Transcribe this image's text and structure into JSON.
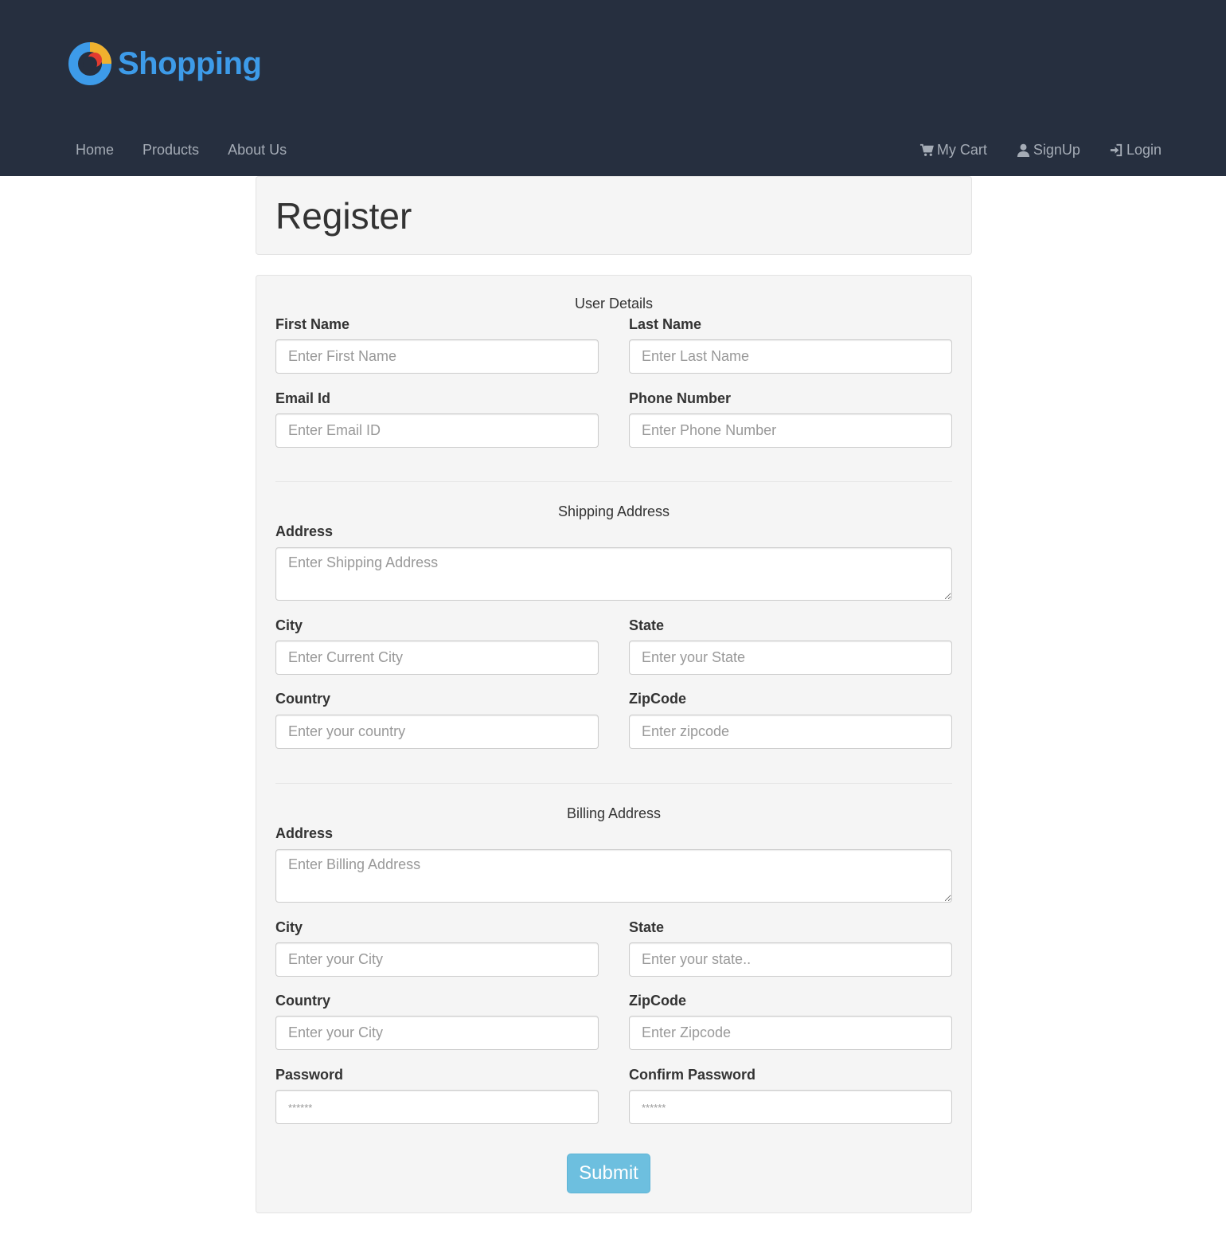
{
  "brand": {
    "name": "Shopping",
    "logo_icon": "shopping-logo-icon",
    "color": "#3d9be9"
  },
  "nav": {
    "left": [
      "Home",
      "Products",
      "About Us"
    ],
    "right": [
      {
        "label": "My Cart",
        "icon": "cart-icon"
      },
      {
        "label": "SignUp",
        "icon": "user-icon"
      },
      {
        "label": "Login",
        "icon": "login-icon"
      }
    ]
  },
  "page": {
    "title": "Register"
  },
  "form": {
    "user_details": {
      "heading": "User Details",
      "first_name": {
        "label": "First Name",
        "placeholder": "Enter First Name"
      },
      "last_name": {
        "label": "Last Name",
        "placeholder": "Enter Last Name"
      },
      "email": {
        "label": "Email Id",
        "placeholder": "Enter Email ID"
      },
      "phone": {
        "label": "Phone Number",
        "placeholder": "Enter Phone Number"
      }
    },
    "shipping": {
      "heading": "Shipping Address",
      "address": {
        "label": "Address",
        "placeholder": "Enter Shipping Address"
      },
      "city": {
        "label": "City",
        "placeholder": "Enter Current City"
      },
      "state": {
        "label": "State",
        "placeholder": "Enter your State"
      },
      "country": {
        "label": "Country",
        "placeholder": "Enter your country"
      },
      "zipcode": {
        "label": "ZipCode",
        "placeholder": "Enter zipcode"
      }
    },
    "billing": {
      "heading": "Billing Address",
      "address": {
        "label": "Address",
        "placeholder": "Enter Billing Address"
      },
      "city": {
        "label": "City",
        "placeholder": "Enter your City"
      },
      "state": {
        "label": "State",
        "placeholder": "Enter your state.."
      },
      "country": {
        "label": "Country",
        "placeholder": "Enter your City"
      },
      "zipcode": {
        "label": "ZipCode",
        "placeholder": "Enter Zipcode"
      }
    },
    "password": {
      "label": "Password",
      "placeholder": "******"
    },
    "confirm_password": {
      "label": "Confirm Password",
      "placeholder": "******"
    },
    "submit_label": "Submit"
  },
  "colors": {
    "header_bg": "#262f3f",
    "nav_text": "#a5acb6",
    "panel_bg": "#f5f5f5",
    "submit_bg": "#6dbfdf"
  }
}
